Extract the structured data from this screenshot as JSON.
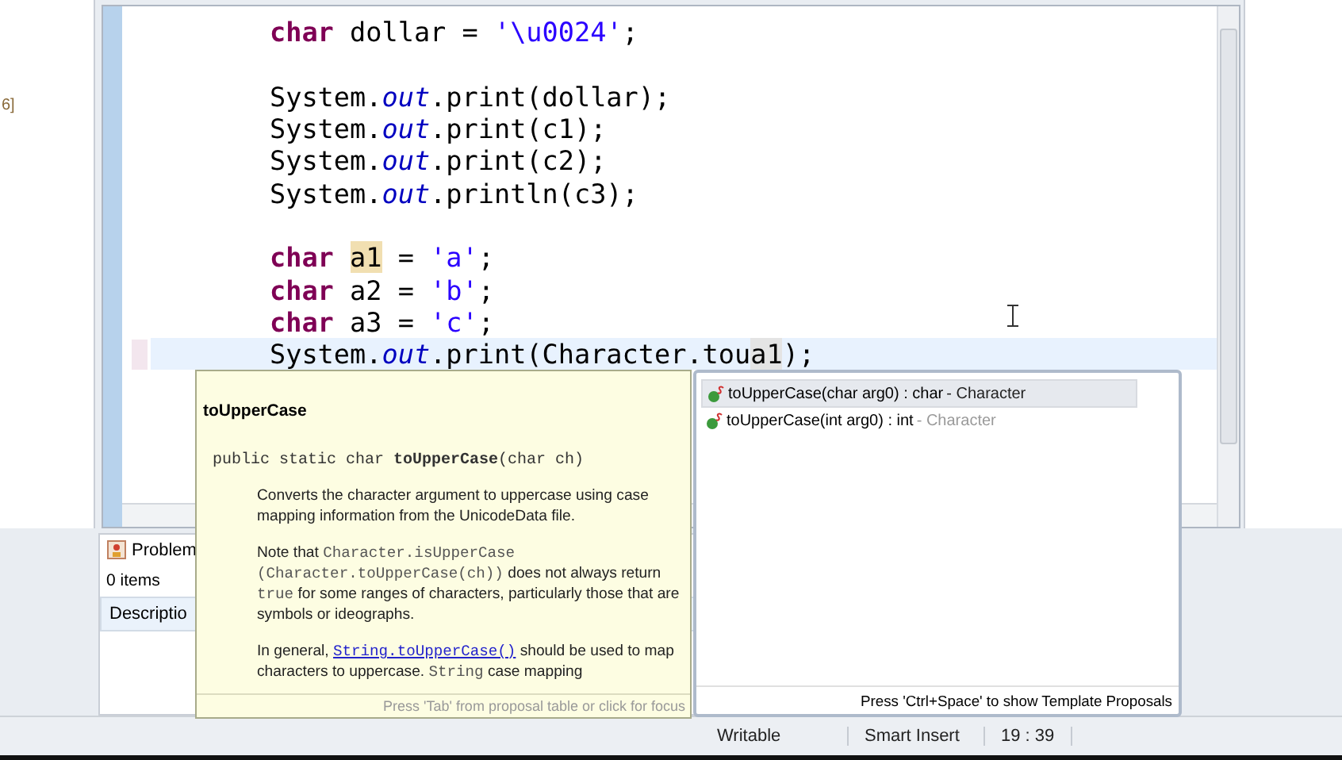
{
  "left_panel": {
    "fragment": "6]"
  },
  "editor": {
    "lines": [
      {
        "kind": "code",
        "current": false,
        "segments": [
          {
            "kind": "keyword",
            "text": "char"
          },
          {
            "kind": "plain",
            "text": " dollar = "
          },
          {
            "kind": "string",
            "text": "'\\u0024'"
          },
          {
            "kind": "plain",
            "text": ";"
          }
        ]
      },
      {
        "kind": "blank",
        "current": false
      },
      {
        "kind": "code",
        "current": false,
        "segments": [
          {
            "kind": "plain",
            "text": "System."
          },
          {
            "kind": "field",
            "text": "out"
          },
          {
            "kind": "plain",
            "text": ".print(dollar);"
          }
        ]
      },
      {
        "kind": "code",
        "current": false,
        "segments": [
          {
            "kind": "plain",
            "text": "System."
          },
          {
            "kind": "field",
            "text": "out"
          },
          {
            "kind": "plain",
            "text": ".print(c1);"
          }
        ]
      },
      {
        "kind": "code",
        "current": false,
        "segments": [
          {
            "kind": "plain",
            "text": "System."
          },
          {
            "kind": "field",
            "text": "out"
          },
          {
            "kind": "plain",
            "text": ".print(c2);"
          }
        ]
      },
      {
        "kind": "code",
        "current": false,
        "segments": [
          {
            "kind": "plain",
            "text": "System."
          },
          {
            "kind": "field",
            "text": "out"
          },
          {
            "kind": "plain",
            "text": ".println(c3);"
          }
        ]
      },
      {
        "kind": "blank",
        "current": false
      },
      {
        "kind": "code",
        "current": false,
        "segments": [
          {
            "kind": "keyword",
            "text": "char "
          },
          {
            "kind": "mark",
            "text": "a1"
          },
          {
            "kind": "plain",
            "text": " = "
          },
          {
            "kind": "string",
            "text": "'a'"
          },
          {
            "kind": "plain",
            "text": ";"
          }
        ]
      },
      {
        "kind": "code",
        "current": false,
        "segments": [
          {
            "kind": "keyword",
            "text": "char"
          },
          {
            "kind": "plain",
            "text": " a2 = "
          },
          {
            "kind": "string",
            "text": "'b'"
          },
          {
            "kind": "plain",
            "text": ";"
          }
        ]
      },
      {
        "kind": "code",
        "current": false,
        "segments": [
          {
            "kind": "keyword",
            "text": "char"
          },
          {
            "kind": "plain",
            "text": " a3 = "
          },
          {
            "kind": "string",
            "text": "'c'"
          },
          {
            "kind": "plain",
            "text": ";"
          }
        ]
      },
      {
        "kind": "code",
        "current": true,
        "segments": [
          {
            "kind": "plain",
            "text": "System."
          },
          {
            "kind": "field",
            "text": "out"
          },
          {
            "kind": "plain",
            "text": ".print(Character.tou"
          },
          {
            "kind": "match",
            "text": "a1"
          },
          {
            "kind": "plain",
            "text": ");"
          }
        ]
      }
    ]
  },
  "doc_popup": {
    "title": "toUpperCase",
    "signature": "public static char **toUpperCase**(char ch)",
    "paragraphs": [
      [
        {
          "kind": "text",
          "text": "Converts the character argument to uppercase using case mapping information from the UnicodeData file."
        }
      ],
      [
        {
          "kind": "text",
          "text": "Note that "
        },
        {
          "kind": "code",
          "text": "Character.isUpperCase (Character.toUpperCase(ch))"
        },
        {
          "kind": "text",
          "text": " does not always return "
        },
        {
          "kind": "code",
          "text": "true"
        },
        {
          "kind": "text",
          "text": " for some ranges of characters, particularly those that are symbols or ideographs."
        }
      ],
      [
        {
          "kind": "text",
          "text": "In general, "
        },
        {
          "kind": "link",
          "text": "String.toUpperCase()"
        },
        {
          "kind": "text",
          "text": " should be used to map characters to uppercase. "
        },
        {
          "kind": "code",
          "text": "String"
        },
        {
          "kind": "text",
          "text": " case mapping"
        }
      ]
    ],
    "footer": "Press 'Tab' from proposal table or click for focus"
  },
  "proposals": {
    "items": [
      {
        "label": "toUpperCase(char arg0) : char",
        "qualifier": " - Character",
        "selected": true
      },
      {
        "label": "toUpperCase(int arg0) : int",
        "qualifier": " - Character",
        "selected": false
      }
    ],
    "footer": "Press 'Ctrl+Space' to show Template Proposals"
  },
  "problems": {
    "tab": "Problem",
    "count": "0 items",
    "column": "Descriptio"
  },
  "status_bar": {
    "cells": [
      "Writable",
      "Smart Insert",
      "19 : 39"
    ]
  }
}
